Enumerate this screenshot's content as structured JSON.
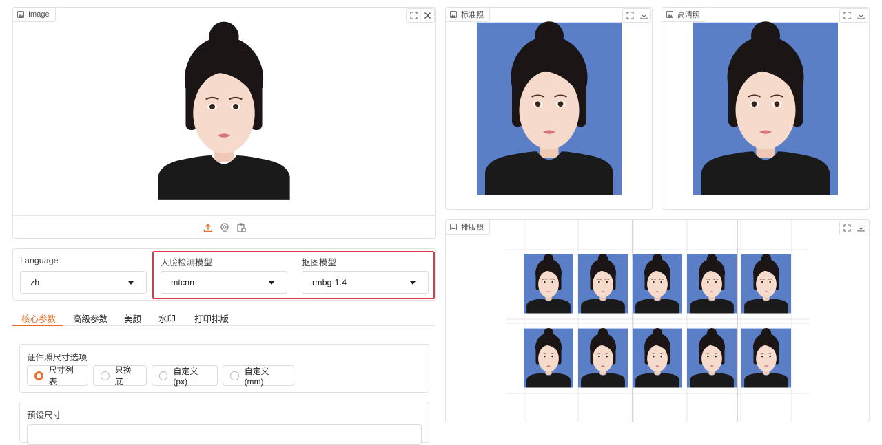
{
  "source": {
    "label": "Image",
    "icons": [
      "image-icon",
      "fullscreen-icon",
      "close-icon"
    ],
    "bottom_icons": [
      "upload-icon",
      "webcam-icon",
      "clipboard-icon"
    ]
  },
  "outputs": {
    "standard": {
      "label": "标准照"
    },
    "hd": {
      "label": "高清照"
    },
    "layout": {
      "label": "排版照"
    },
    "background_color": "#5b7fc7",
    "icons": [
      "fullscreen-icon",
      "download-icon"
    ]
  },
  "settings": {
    "language": {
      "label": "Language",
      "value": "zh"
    },
    "face_model": {
      "label": "人脸检测模型",
      "value": "mtcnn"
    },
    "matting_model": {
      "label": "抠图模型",
      "value": "rmbg-1.4"
    }
  },
  "tabs": [
    {
      "label": "核心参数",
      "active": true
    },
    {
      "label": "高级参数"
    },
    {
      "label": "美颜"
    },
    {
      "label": "水印"
    },
    {
      "label": "打印排版"
    }
  ],
  "size_options": {
    "label": "证件照尺寸选项",
    "options": [
      "尺寸列表",
      "只换底",
      "自定义(px)",
      "自定义(mm)"
    ],
    "selected": "尺寸列表"
  },
  "preset": {
    "label": "预设尺寸"
  },
  "colors": {
    "accent": "#e8702a",
    "highlight": "#e0364b"
  }
}
